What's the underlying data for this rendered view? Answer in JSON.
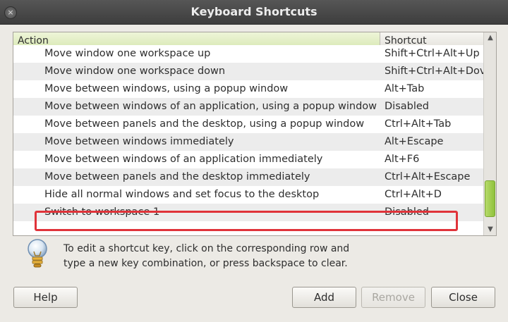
{
  "window": {
    "title": "Keyboard Shortcuts",
    "close_glyph": "×"
  },
  "table": {
    "columns": {
      "action": "Action",
      "shortcut": "Shortcut"
    },
    "rows": [
      {
        "action": "Move window one workspace up",
        "shortcut": "Shift+Ctrl+Alt+Up"
      },
      {
        "action": "Move window one workspace down",
        "shortcut": "Shift+Ctrl+Alt+Dov"
      },
      {
        "action": "Move between windows, using a popup window",
        "shortcut": "Alt+Tab"
      },
      {
        "action": "Move between windows of an application, using a popup window",
        "shortcut": "Disabled"
      },
      {
        "action": "Move between panels and the desktop, using a popup window",
        "shortcut": "Ctrl+Alt+Tab"
      },
      {
        "action": "Move between windows immediately",
        "shortcut": "Alt+Escape"
      },
      {
        "action": "Move between windows of an application immediately",
        "shortcut": "Alt+F6"
      },
      {
        "action": "Move between panels and the desktop immediately",
        "shortcut": "Ctrl+Alt+Escape"
      },
      {
        "action": "Hide all normal windows and set focus to the desktop",
        "shortcut": "Ctrl+Alt+D"
      },
      {
        "action": "Switch to workspace 1",
        "shortcut": "Disabled"
      }
    ],
    "highlight_color": "#e0333a",
    "scrollbar_color": "#9cc94a"
  },
  "hint": {
    "icon": "lightbulb-icon",
    "text": "To edit a shortcut key, click on the corresponding row and type a new key combination, or press backspace to clear."
  },
  "buttons": {
    "help": "Help",
    "add": "Add",
    "remove": "Remove",
    "close": "Close"
  }
}
